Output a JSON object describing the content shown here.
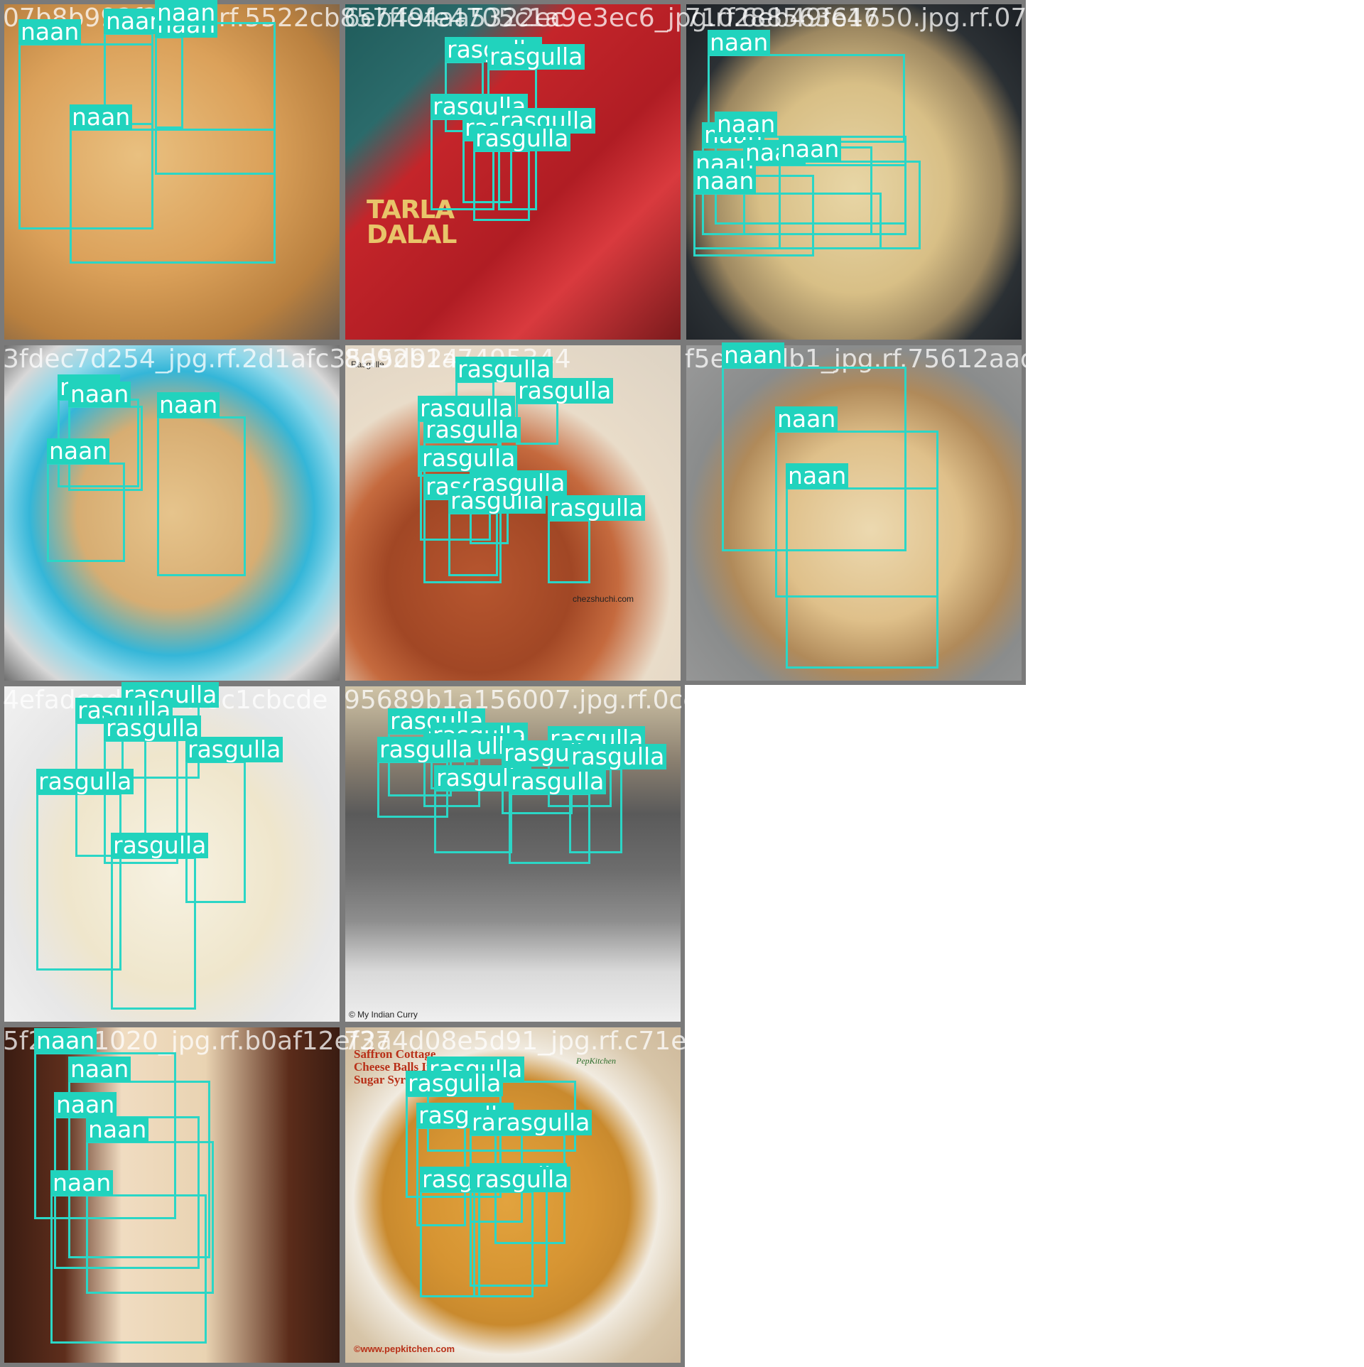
{
  "mosaic": {
    "box_color": "#2bd6c6",
    "label_bg": "#21d3bd",
    "label_text_color": "#ffffff",
    "tiles": [
      {
        "name": "07b8b992f2_jpg.rf.5522cb857ffe4aa5322ec",
        "background": "radial-gradient(ellipse at 40% 45%, #e9c080 0%, #dba15a 45%, #b9803f 75%, #6b5a4a 100%)",
        "detections": [
          {
            "label": "naan"
          },
          {
            "label": "naan"
          },
          {
            "label": "naan"
          },
          {
            "label": "naan"
          },
          {
            "label": "naan"
          }
        ]
      },
      {
        "name": "6eb49fe4705c1a9e3ec6_jpg.rf.6eb49fe47",
        "background": "linear-gradient(135deg, #1f5b5a 0%, #2b6b6b 22%, #c4252a 35%, #b01d24 60%, #d93a3e 75%, #7a1a1c 100%)",
        "texts": [
          {
            "text": "TARLA",
            "class": "tarla"
          },
          {
            "text": "DALAL",
            "class": "tarla"
          }
        ],
        "detections": [
          {
            "label": "rasgulla"
          },
          {
            "label": "rasgulla"
          },
          {
            "label": "rasgulla"
          },
          {
            "label": "rasgulla"
          },
          {
            "label": "rasgulla"
          },
          {
            "label": "rasgulla"
          }
        ]
      },
      {
        "name": "71028856361650.jpg.rf.07945a9670b1f9f1349c89",
        "background": "radial-gradient(ellipse at 50% 55%, #e8d6a6 0%, #d8bf86 40%, #9c8760 62%, #2b3034 75%, #1b1f24 100%)",
        "detections": [
          {
            "label": "naan"
          },
          {
            "label": "naan"
          },
          {
            "label": "naan"
          },
          {
            "label": "naan"
          },
          {
            "label": "naan"
          },
          {
            "label": "naan"
          },
          {
            "label": "naan"
          }
        ]
      },
      {
        "name": "3fdec7d254_jpg.rf.2d1afc35a5d924",
        "background": "radial-gradient(ellipse at 50% 50%, #e6c48c 0%, #d7ad72 40%, #34b6d8 60%, #8fd8ea 72%, #d8d8d8 85%, #6e6e6e 100%)",
        "detections": [
          {
            "label": "naan"
          },
          {
            "label": "naan"
          },
          {
            "label": "naan"
          },
          {
            "label": "naan"
          }
        ]
      },
      {
        "name": "8d92b1a7495344",
        "background": "radial-gradient(circle at 40% 70%, #b7562f 0%, #a14725 30%, #c56a3e 45%, #e9dcc9 62%, #dcd2c3 100%)",
        "texts": [
          {
            "text": "Rasgulle",
            "class": "small"
          },
          {
            "text": "chezshuchi.com",
            "class": "small"
          }
        ],
        "detections": [
          {
            "label": "rasgulla"
          },
          {
            "label": "rasgulla"
          },
          {
            "label": "rasgulla"
          },
          {
            "label": "rasgulla"
          },
          {
            "label": "rasgulla"
          },
          {
            "label": "rasgulla"
          },
          {
            "label": "rasgulla"
          },
          {
            "label": "rasgulla"
          },
          {
            "label": "rasgulla"
          }
        ]
      },
      {
        "name": "f5e0c3db1_jpg.rf.75612aadc559d13319229a",
        "background": "radial-gradient(ellipse at 55% 55%, #ecd9b0 0%, #dfc08a 35%, #b08a5a 55%, #8a8c8c 70%, #9a9a9a 100%)",
        "detections": [
          {
            "label": "naan"
          },
          {
            "label": "naan"
          },
          {
            "label": "naan"
          }
        ]
      },
      {
        "name": "4efadced4bf94f8c1cbcde",
        "background": "radial-gradient(ellipse at 50% 55%, #f7f2e2 0%, #efe6cc 45%, #e7e7e7 70%, #f2f2f2 100%)",
        "detections": [
          {
            "label": "rasgulla"
          },
          {
            "label": "rasgulla"
          },
          {
            "label": "rasgulla"
          },
          {
            "label": "rasgulla"
          },
          {
            "label": "rasgulla"
          },
          {
            "label": "rasgulla"
          }
        ]
      },
      {
        "name": "95689b1a156007.jpg.rf.0ccb1c7f8def2ca38e4be7",
        "background": "linear-gradient(180deg, #cfc3a6 0%, #8b8070 22%, #5a5a5a 38%, #6d6d6d 55%, #8e8e8e 70%, #d9d9d9 85%, #efefef 100%)",
        "texts": [
          {
            "text": "© My Indian Curry",
            "class": "small"
          }
        ],
        "detections": [
          {
            "label": "rasgulla"
          },
          {
            "label": "rasgulla"
          },
          {
            "label": "rasgulla"
          },
          {
            "label": "rasgulla"
          },
          {
            "label": "rasgulla"
          },
          {
            "label": "rasgulla"
          },
          {
            "label": "rasgulla"
          },
          {
            "label": "rasgulla"
          },
          {
            "label": "rasgulla"
          }
        ]
      },
      {
        "name": "5f28401020_jpg.rf.b0af12ef37",
        "background": "linear-gradient(90deg, #3a1c12 0%, #5e2e1c 18%, #f0dcc1 35%, #e9d3b2 60%, #5b2c1a 85%, #3a1c12 100%)",
        "detections": [
          {
            "label": "naan"
          },
          {
            "label": "naan"
          },
          {
            "label": "naan"
          },
          {
            "label": "naan"
          },
          {
            "label": "naan"
          }
        ]
      },
      {
        "name": "72a4d08e5d91_jpg.rf.c71e0d628d0b31aac744c9",
        "background": "radial-gradient(circle at 48% 52%, #e2a33e 0%, #d69432 35%, #c98a2e 50%, #f1ebe0 62%, #d7c5a8 80%, #cdb89a 100%)",
        "texts": [
          {
            "text": "Saffron Cottage",
            "class": "pep-title"
          },
          {
            "text": "Cheese Balls In",
            "class": "pep-title"
          },
          {
            "text": "Sugar Syrup",
            "class": "pep-title"
          },
          {
            "text": "PepKitchen",
            "class": "pep-brand"
          },
          {
            "text": "©www.pepkitchen.com",
            "class": "pep-url"
          }
        ],
        "detections": [
          {
            "label": "rasgulla"
          },
          {
            "label": "rasgulla"
          },
          {
            "label": "rasgulla"
          },
          {
            "label": "rasgulla"
          },
          {
            "label": "rasgulla"
          },
          {
            "label": "rasgulla"
          },
          {
            "label": "rasgulla"
          },
          {
            "label": "rasgulla"
          }
        ]
      }
    ]
  }
}
